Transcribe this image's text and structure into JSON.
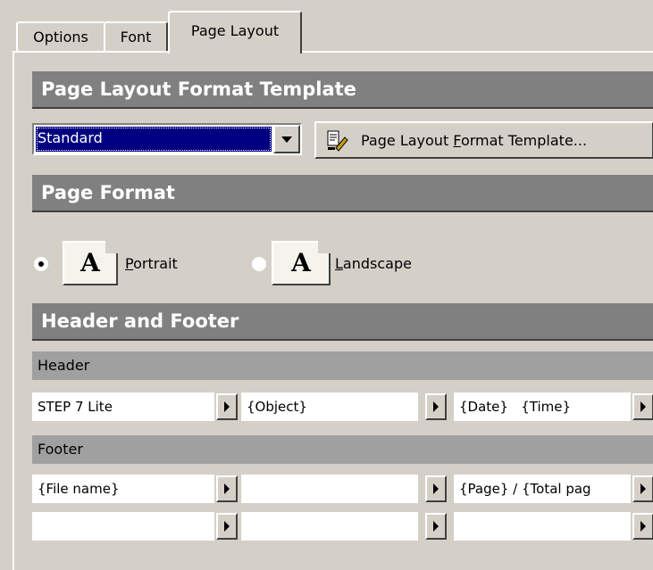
{
  "tabs": [
    {
      "label": "Options",
      "active": false
    },
    {
      "label": "Font",
      "active": false
    },
    {
      "label": "Page Layout",
      "active": true
    }
  ],
  "template_section": {
    "title": "Page Layout Format Template",
    "selected": "Standard",
    "button_label_pre": "Page Layout ",
    "button_label_accel": "F",
    "button_label_post": "ormat Template..."
  },
  "page_format": {
    "title": "Page Format",
    "portrait": {
      "accel": "P",
      "rest": "ortrait",
      "glyph": "A",
      "checked": true
    },
    "landscape": {
      "accel": "L",
      "rest": "andscape",
      "glyph": "A",
      "checked": false
    }
  },
  "header_footer": {
    "title": "Header and Footer",
    "header_label": "Header",
    "footer_label": "Footer",
    "header_fields": [
      "STEP 7 Lite",
      "{Object}",
      "{Date}   {Time}"
    ],
    "footer_rows": [
      [
        "{File name}",
        "",
        "{Page} / {Total pag"
      ],
      [
        "",
        "",
        ""
      ]
    ]
  },
  "colors": {
    "selection": "#000080",
    "section_bg": "#808080",
    "subsection_bg": "#a0a0a0",
    "face": "#d4d0c8"
  }
}
